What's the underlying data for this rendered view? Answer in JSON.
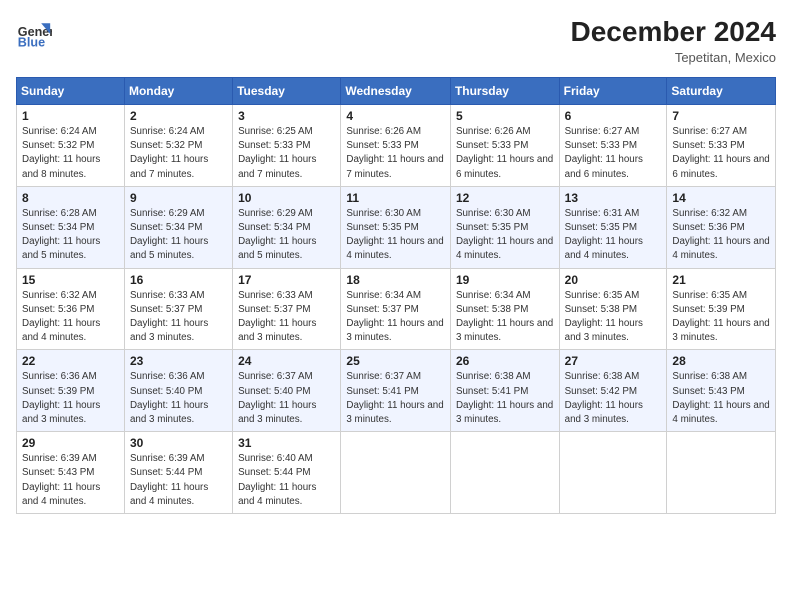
{
  "header": {
    "logo_line1": "General",
    "logo_line2": "Blue",
    "month": "December 2024",
    "location": "Tepetitan, Mexico"
  },
  "days_of_week": [
    "Sunday",
    "Monday",
    "Tuesday",
    "Wednesday",
    "Thursday",
    "Friday",
    "Saturday"
  ],
  "weeks": [
    [
      {
        "day": "1",
        "sunrise": "6:24 AM",
        "sunset": "5:32 PM",
        "daylight": "11 hours and 8 minutes."
      },
      {
        "day": "2",
        "sunrise": "6:24 AM",
        "sunset": "5:32 PM",
        "daylight": "11 hours and 7 minutes."
      },
      {
        "day": "3",
        "sunrise": "6:25 AM",
        "sunset": "5:33 PM",
        "daylight": "11 hours and 7 minutes."
      },
      {
        "day": "4",
        "sunrise": "6:26 AM",
        "sunset": "5:33 PM",
        "daylight": "11 hours and 7 minutes."
      },
      {
        "day": "5",
        "sunrise": "6:26 AM",
        "sunset": "5:33 PM",
        "daylight": "11 hours and 6 minutes."
      },
      {
        "day": "6",
        "sunrise": "6:27 AM",
        "sunset": "5:33 PM",
        "daylight": "11 hours and 6 minutes."
      },
      {
        "day": "7",
        "sunrise": "6:27 AM",
        "sunset": "5:33 PM",
        "daylight": "11 hours and 6 minutes."
      }
    ],
    [
      {
        "day": "8",
        "sunrise": "6:28 AM",
        "sunset": "5:34 PM",
        "daylight": "11 hours and 5 minutes."
      },
      {
        "day": "9",
        "sunrise": "6:29 AM",
        "sunset": "5:34 PM",
        "daylight": "11 hours and 5 minutes."
      },
      {
        "day": "10",
        "sunrise": "6:29 AM",
        "sunset": "5:34 PM",
        "daylight": "11 hours and 5 minutes."
      },
      {
        "day": "11",
        "sunrise": "6:30 AM",
        "sunset": "5:35 PM",
        "daylight": "11 hours and 4 minutes."
      },
      {
        "day": "12",
        "sunrise": "6:30 AM",
        "sunset": "5:35 PM",
        "daylight": "11 hours and 4 minutes."
      },
      {
        "day": "13",
        "sunrise": "6:31 AM",
        "sunset": "5:35 PM",
        "daylight": "11 hours and 4 minutes."
      },
      {
        "day": "14",
        "sunrise": "6:32 AM",
        "sunset": "5:36 PM",
        "daylight": "11 hours and 4 minutes."
      }
    ],
    [
      {
        "day": "15",
        "sunrise": "6:32 AM",
        "sunset": "5:36 PM",
        "daylight": "11 hours and 4 minutes."
      },
      {
        "day": "16",
        "sunrise": "6:33 AM",
        "sunset": "5:37 PM",
        "daylight": "11 hours and 3 minutes."
      },
      {
        "day": "17",
        "sunrise": "6:33 AM",
        "sunset": "5:37 PM",
        "daylight": "11 hours and 3 minutes."
      },
      {
        "day": "18",
        "sunrise": "6:34 AM",
        "sunset": "5:37 PM",
        "daylight": "11 hours and 3 minutes."
      },
      {
        "day": "19",
        "sunrise": "6:34 AM",
        "sunset": "5:38 PM",
        "daylight": "11 hours and 3 minutes."
      },
      {
        "day": "20",
        "sunrise": "6:35 AM",
        "sunset": "5:38 PM",
        "daylight": "11 hours and 3 minutes."
      },
      {
        "day": "21",
        "sunrise": "6:35 AM",
        "sunset": "5:39 PM",
        "daylight": "11 hours and 3 minutes."
      }
    ],
    [
      {
        "day": "22",
        "sunrise": "6:36 AM",
        "sunset": "5:39 PM",
        "daylight": "11 hours and 3 minutes."
      },
      {
        "day": "23",
        "sunrise": "6:36 AM",
        "sunset": "5:40 PM",
        "daylight": "11 hours and 3 minutes."
      },
      {
        "day": "24",
        "sunrise": "6:37 AM",
        "sunset": "5:40 PM",
        "daylight": "11 hours and 3 minutes."
      },
      {
        "day": "25",
        "sunrise": "6:37 AM",
        "sunset": "5:41 PM",
        "daylight": "11 hours and 3 minutes."
      },
      {
        "day": "26",
        "sunrise": "6:38 AM",
        "sunset": "5:41 PM",
        "daylight": "11 hours and 3 minutes."
      },
      {
        "day": "27",
        "sunrise": "6:38 AM",
        "sunset": "5:42 PM",
        "daylight": "11 hours and 3 minutes."
      },
      {
        "day": "28",
        "sunrise": "6:38 AM",
        "sunset": "5:43 PM",
        "daylight": "11 hours and 4 minutes."
      }
    ],
    [
      {
        "day": "29",
        "sunrise": "6:39 AM",
        "sunset": "5:43 PM",
        "daylight": "11 hours and 4 minutes."
      },
      {
        "day": "30",
        "sunrise": "6:39 AM",
        "sunset": "5:44 PM",
        "daylight": "11 hours and 4 minutes."
      },
      {
        "day": "31",
        "sunrise": "6:40 AM",
        "sunset": "5:44 PM",
        "daylight": "11 hours and 4 minutes."
      },
      null,
      null,
      null,
      null
    ]
  ],
  "labels": {
    "sunrise": "Sunrise:",
    "sunset": "Sunset:",
    "daylight": "Daylight:"
  }
}
